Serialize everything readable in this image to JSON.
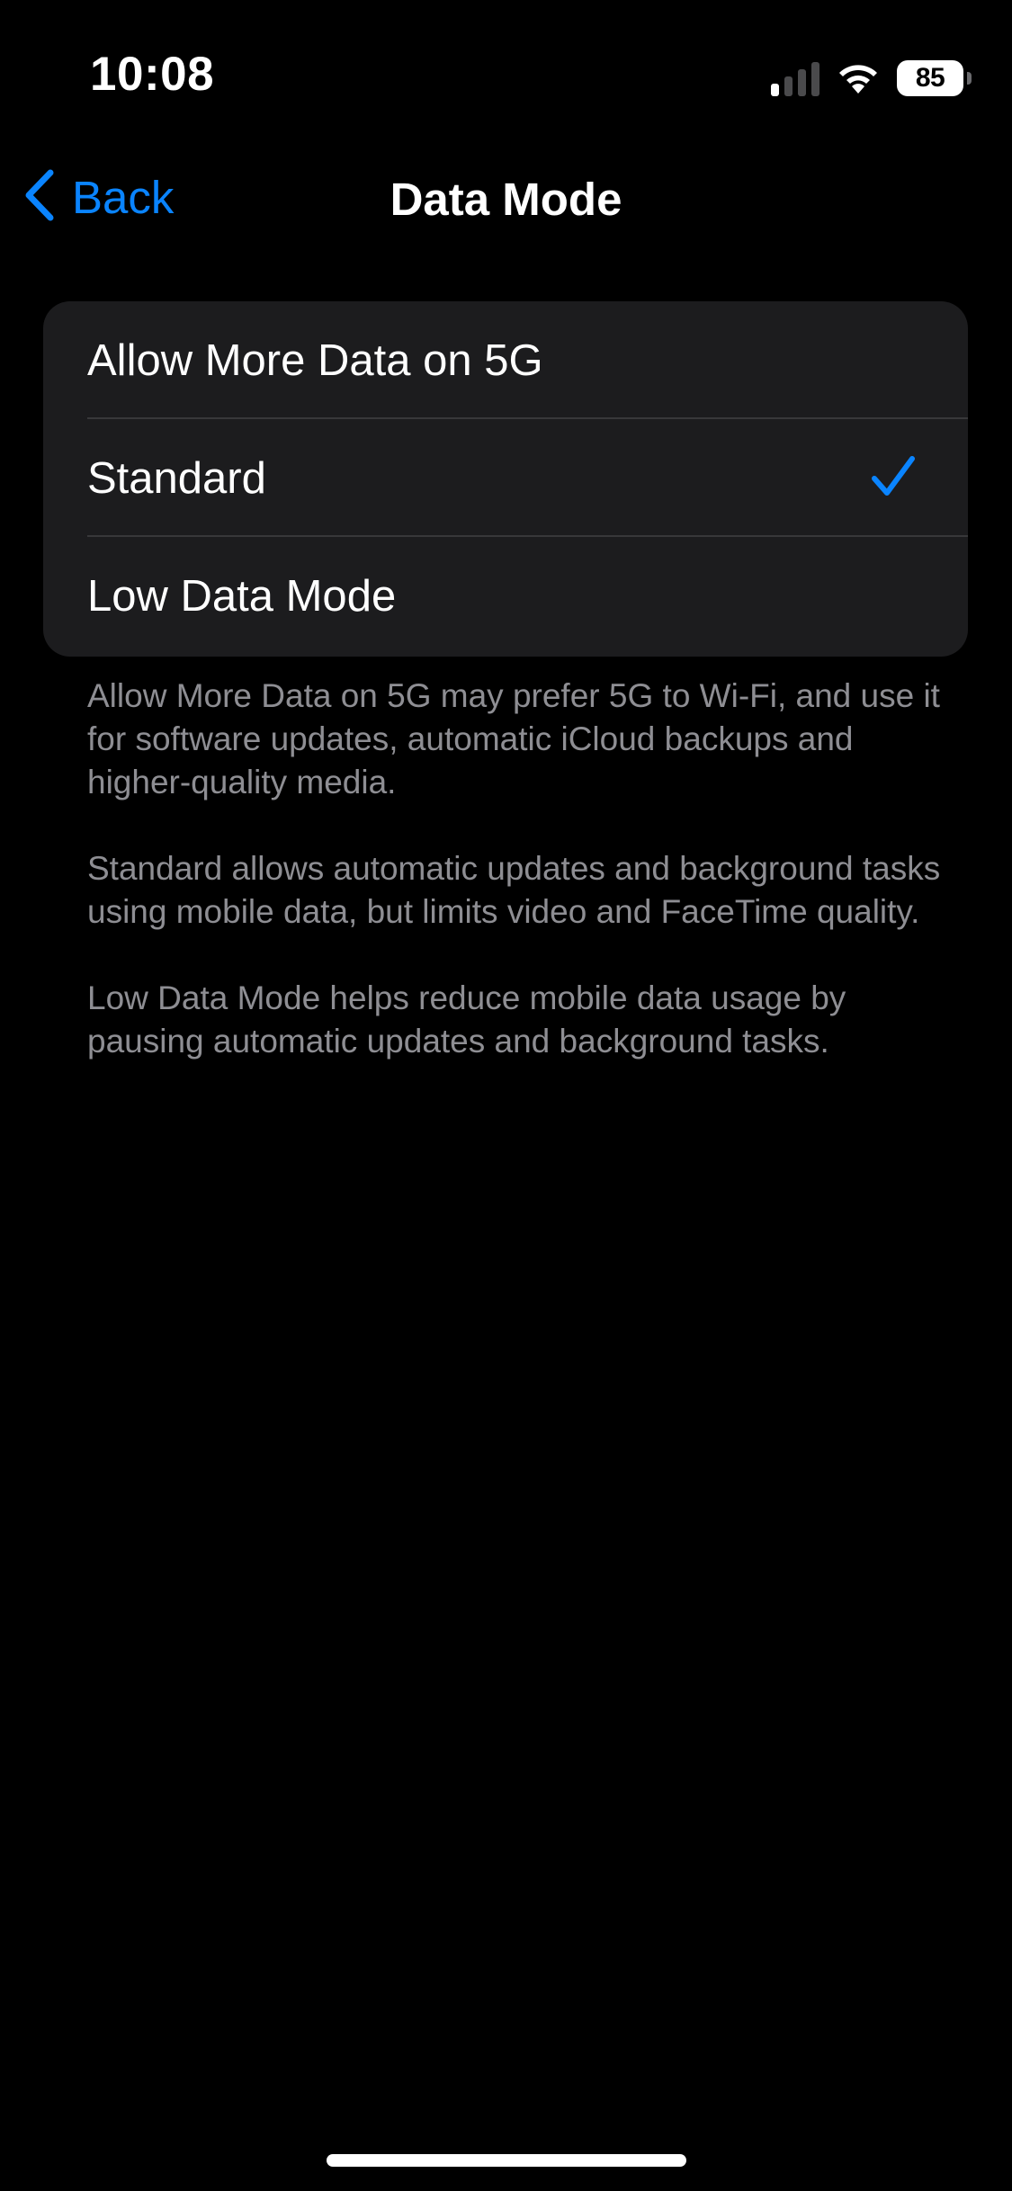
{
  "status_bar": {
    "time": "10:08",
    "battery_level": "85",
    "icons": [
      "cellular-signal-icon",
      "wifi-icon",
      "battery-icon"
    ]
  },
  "nav": {
    "back_label": "Back",
    "title": "Data Mode"
  },
  "options": [
    {
      "label": "Allow More Data on 5G",
      "selected": false
    },
    {
      "label": "Standard",
      "selected": true
    },
    {
      "label": "Low Data Mode",
      "selected": false
    }
  ],
  "descriptions": [
    "Allow More Data on 5G may prefer 5G to Wi-Fi, and use it for software updates, automatic iCloud backups and higher-quality media.",
    "Standard allows automatic updates and background tasks using mobile data, but limits video and FaceTime quality.",
    "Low Data Mode helps reduce mobile data usage by pausing automatic updates and background tasks."
  ],
  "colors": {
    "background": "#000000",
    "group_background": "#1c1c1e",
    "accent": "#0a84ff",
    "secondary_text": "#8e8e93",
    "separator": "#38383a"
  }
}
